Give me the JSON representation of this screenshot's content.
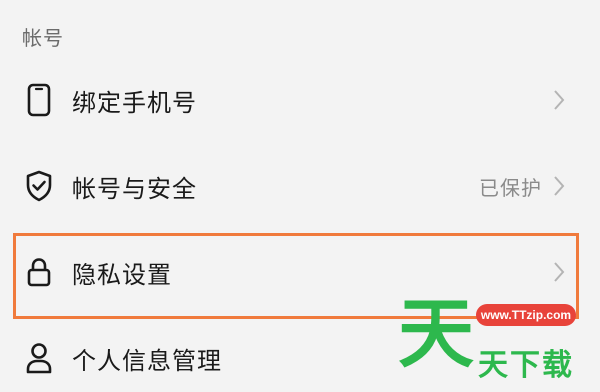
{
  "section": {
    "title": "帐号"
  },
  "rows": [
    {
      "label": "绑定手机号",
      "icon": "phone-icon",
      "status": ""
    },
    {
      "label": "帐号与安全",
      "icon": "shield-check-icon",
      "status": "已保护"
    },
    {
      "label": "隐私设置",
      "icon": "lock-icon",
      "status": ""
    },
    {
      "label": "个人信息管理",
      "icon": "person-icon",
      "status": ""
    }
  ],
  "watermark": {
    "big_char": "天",
    "url": "www.TTzip.com",
    "text": "天下载"
  },
  "colors": {
    "background": "#f3f3f3",
    "highlight": "#f07a3c",
    "watermark_green": "#2db84d",
    "watermark_red": "#e8433a"
  }
}
